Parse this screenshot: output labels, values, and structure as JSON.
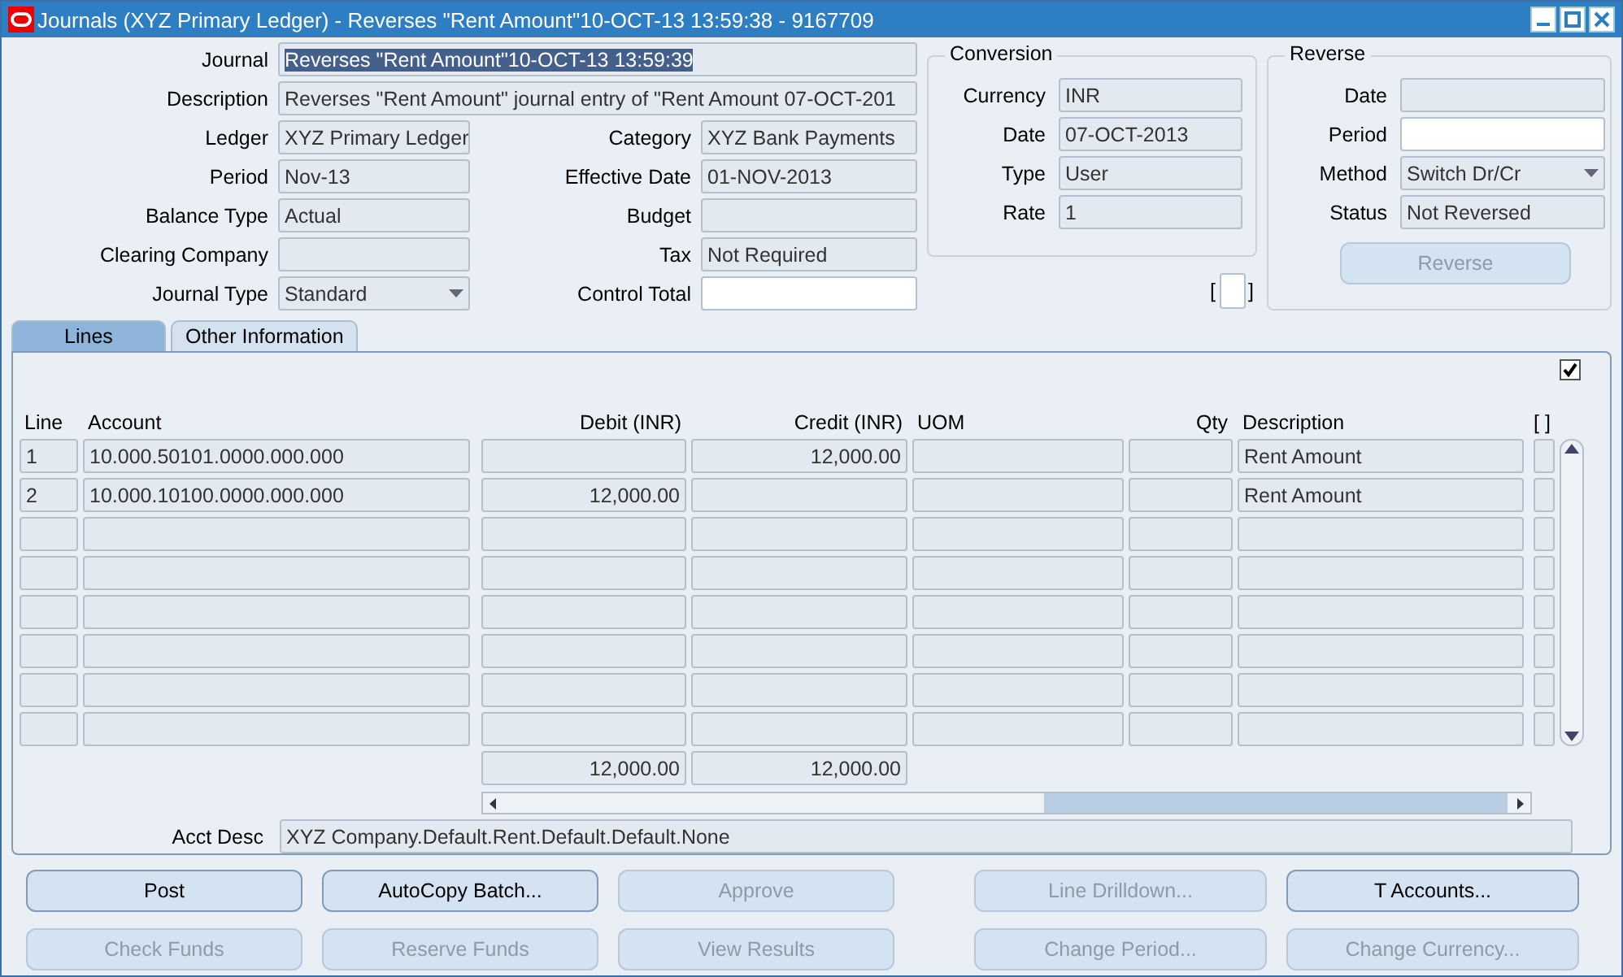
{
  "window": {
    "title": "Journals (XYZ Primary Ledger) - Reverses \"Rent Amount\"10-OCT-13 13:59:38 - 9167709"
  },
  "header": {
    "journal": {
      "label": "Journal",
      "value": "Reverses \"Rent Amount\"10-OCT-13 13:59:39",
      "highlighted": true
    },
    "description": {
      "label": "Description",
      "value": "Reverses \"Rent Amount\" journal entry of \"Rent Amount 07-OCT-201",
      "readonly": true
    },
    "fields": [
      {
        "label": "Ledger",
        "value": "XYZ Primary Ledger",
        "kind": "text",
        "readonly": true
      },
      {
        "label": "Category",
        "value": "XYZ Bank Payments",
        "kind": "text",
        "readonly": true
      },
      {
        "label": "Period",
        "value": "Nov-13",
        "kind": "text",
        "readonly": true
      },
      {
        "label": "Effective Date",
        "value": "01-NOV-2013",
        "kind": "text",
        "readonly": true
      },
      {
        "label": "Balance Type",
        "value": "Actual",
        "kind": "text",
        "readonly": true
      },
      {
        "label": "Budget",
        "kind": "text",
        "readonly": true
      },
      {
        "label": "Clearing Company",
        "kind": "text",
        "readonly": true
      },
      {
        "label": "Tax",
        "value": "Not Required",
        "kind": "text",
        "readonly": true
      },
      {
        "label": "Journal Type",
        "value": "Standard",
        "kind": "select",
        "readonly": true
      },
      {
        "label": "Control Total",
        "kind": "text",
        "readonly": false
      }
    ]
  },
  "conversion": {
    "title": "Conversion",
    "fields": [
      {
        "label": "Currency",
        "value": "INR",
        "kind": "text",
        "readonly": true
      },
      {
        "label": "Date",
        "value": "07-OCT-2013",
        "kind": "text",
        "readonly": true
      },
      {
        "label": "Type",
        "value": "User",
        "kind": "text",
        "readonly": true
      },
      {
        "label": "Rate",
        "value": "1",
        "kind": "text",
        "readonly": true
      }
    ],
    "flex_field": {
      "open": "[",
      "close": "]"
    }
  },
  "reverse": {
    "title": "Reverse",
    "fields": [
      {
        "label": "Date",
        "kind": "text",
        "readonly": true
      },
      {
        "label": "Period",
        "kind": "text",
        "readonly": false
      },
      {
        "label": "Method",
        "value": "Switch Dr/Cr",
        "kind": "select",
        "readonly": true
      },
      {
        "label": "Status",
        "value": "Not Reversed",
        "kind": "text",
        "readonly": true
      }
    ],
    "button": {
      "label": "Reverse",
      "disabled": true
    }
  },
  "tabs": [
    {
      "label": "Lines",
      "selected": true
    },
    {
      "label": "Other Information",
      "selected": false
    }
  ],
  "lines": {
    "show_all_checked": true,
    "columns": [
      "Line",
      "Account",
      "Debit (INR)",
      "Credit (INR)",
      "UOM",
      "Qty",
      "Description",
      "[ ]"
    ],
    "rows": [
      {
        "line": "1",
        "account": "10.000.50101.0000.000.000",
        "credit": "12,000.00",
        "description": "Rent Amount"
      },
      {
        "line": "2",
        "account": "10.000.10100.0000.000.000",
        "debit": "12,000.00",
        "description": "Rent Amount"
      }
    ],
    "total_debit": "12,000.00",
    "total_credit": "12,000.00",
    "acct_desc": {
      "label": "Acct Desc",
      "value": "XYZ Company.Default.Rent.Default.Default.None"
    }
  },
  "buttons": [
    [
      {
        "label": "Post",
        "disabled": false
      },
      {
        "label": "AutoCopy Batch...",
        "disabled": false
      },
      {
        "label": "Approve",
        "disabled": true
      },
      {
        "label": "Line Drilldown...",
        "disabled": true
      },
      {
        "label": "T Accounts...",
        "disabled": false
      }
    ],
    [
      {
        "label": "Check Funds",
        "disabled": true
      },
      {
        "label": "Reserve Funds",
        "disabled": true
      },
      {
        "label": "View Results",
        "disabled": true
      },
      {
        "label": "Change Period...",
        "disabled": true
      },
      {
        "label": "Change Currency...",
        "disabled": true
      }
    ]
  ]
}
